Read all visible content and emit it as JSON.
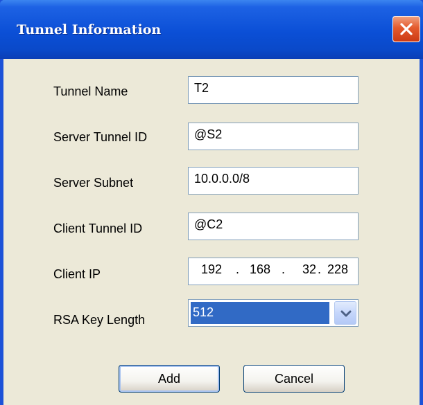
{
  "dialog": {
    "title": "Tunnel Information",
    "close_icon": "close-icon"
  },
  "fields": {
    "tunnel_name": {
      "label": "Tunnel Name",
      "value": "T2"
    },
    "server_tunnel_id": {
      "label": "Server Tunnel ID",
      "value": "@S2"
    },
    "server_subnet": {
      "label": "Server Subnet",
      "value": "10.0.0.0/8"
    },
    "client_tunnel_id": {
      "label": "Client Tunnel ID",
      "value": "@C2"
    },
    "client_ip": {
      "label": "Client IP",
      "octets": [
        "192",
        "168",
        "32",
        "228"
      ],
      "separator": "."
    },
    "rsa_key_length": {
      "label": "RSA Key Length",
      "selected": "512",
      "dropdown_icon": "chevron-down-icon"
    }
  },
  "buttons": {
    "add": "Add",
    "cancel": "Cancel"
  },
  "colors": {
    "title_bar": "#0b4fd6",
    "selection": "#316ac5",
    "close_button": "#e45a2d",
    "dialog_background": "#ece9d8"
  }
}
